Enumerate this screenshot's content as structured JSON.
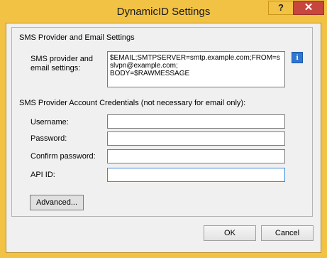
{
  "window": {
    "title": "DynamicID Settings",
    "help_label": "?",
    "close_label": "✕"
  },
  "group": {
    "title": "SMS Provider and Email Settings",
    "sms_settings_label": "SMS provider and email settings:",
    "sms_settings_value": "$EMAIL;SMTPSERVER=smtp.example.com;FROM=sslvpn@example.com;\nBODY=$RAWMESSAGE",
    "info_icon_glyph": "i",
    "credentials_title": "SMS Provider Account Credentials (not necessary for email only):",
    "username_label": "Username:",
    "password_label": "Password:",
    "confirm_password_label": "Confirm password:",
    "api_id_label": "API ID:",
    "username_value": "",
    "password_value": "",
    "confirm_password_value": "",
    "api_id_value": "",
    "advanced_label": "Advanced..."
  },
  "footer": {
    "ok_label": "OK",
    "cancel_label": "Cancel"
  },
  "colors": {
    "title_bar": "#f2c244",
    "close_button": "#c7463d",
    "info_icon": "#2f76d2",
    "focus_border": "#3c8bd8"
  },
  "icons": {
    "help": "help-icon",
    "close": "close-icon",
    "info": "info-icon"
  }
}
